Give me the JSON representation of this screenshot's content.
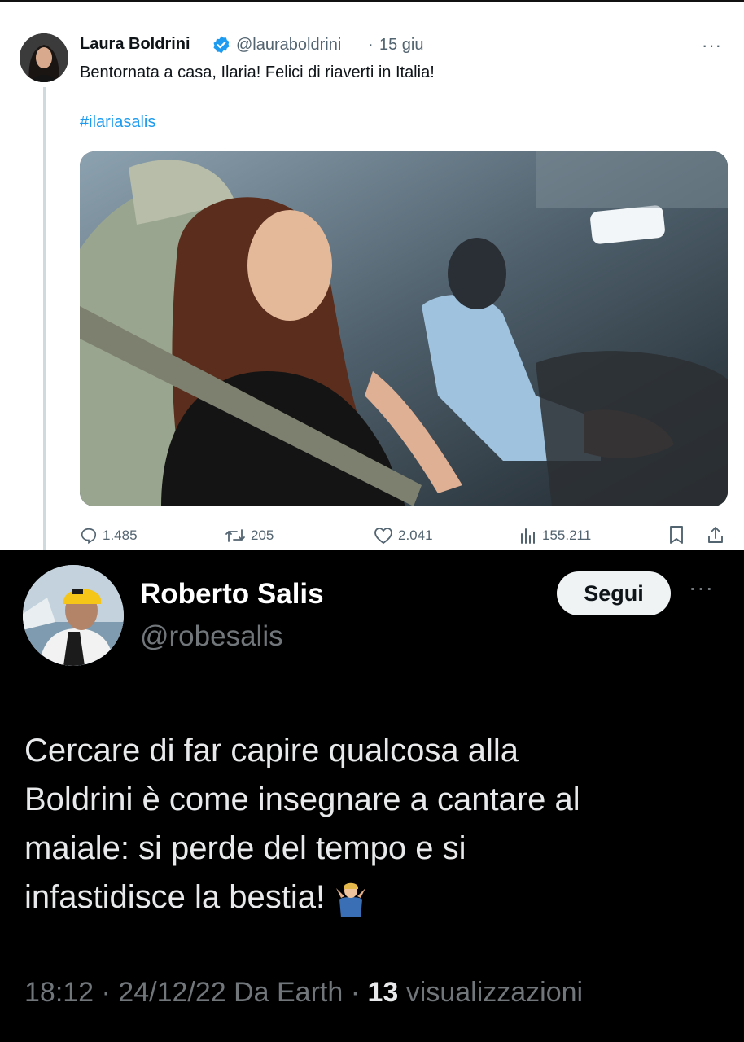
{
  "top_tweet": {
    "author_name": "Laura Boldrini",
    "handle": "@lauraboldrini",
    "separator": "·",
    "date": "15 giu",
    "more": "···",
    "text": "Bentornata a casa, Ilaria! Felici di riaverti in Italia!",
    "hashtag": "#ilariasalis",
    "stats": {
      "replies": "1.485",
      "retweets": "205",
      "likes": "2.041",
      "views": "155.211"
    }
  },
  "bottom_tweet": {
    "author_name": "Roberto Salis",
    "handle": "@robesalis",
    "follow_label": "Segui",
    "more": "···",
    "text_lines": [
      "Cercare di far capire qualcosa alla",
      "Boldrini è come insegnare a cantare al",
      "maiale: si perde del tempo e si",
      "infastidisce la bestia!"
    ],
    "emoji": "man-shrugging-emoji",
    "meta": {
      "time_date": "18:12 · 24/12/22 Da Earth ·",
      "views_count": "13",
      "views_label": "visualizzazioni"
    }
  },
  "colors": {
    "link_blue": "#1d9bf0",
    "verified_blue": "#1d9bf0",
    "dark_bg": "#000000",
    "muted_gray": "#536471"
  }
}
